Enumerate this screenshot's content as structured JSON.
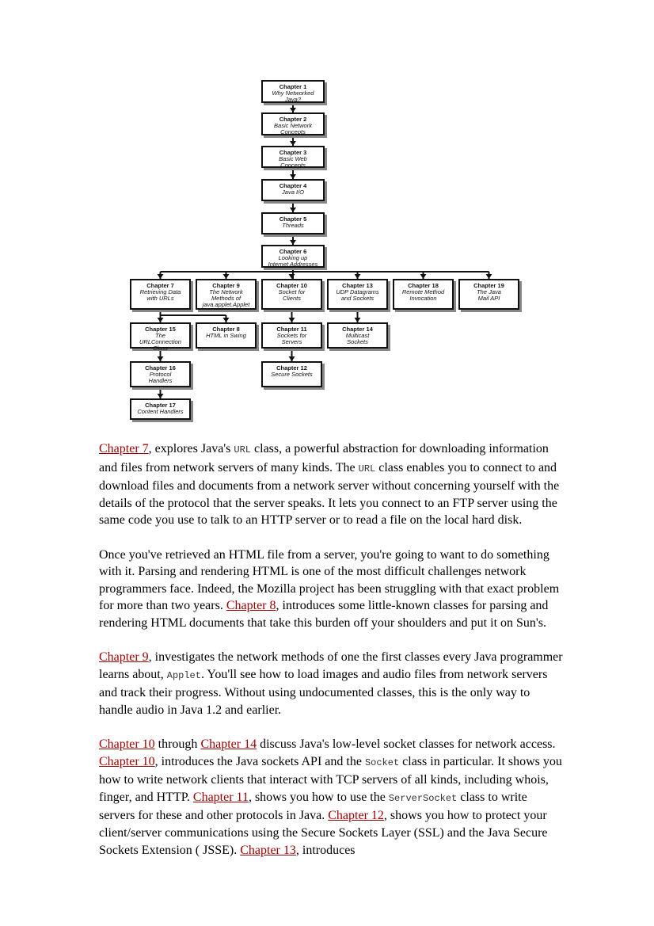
{
  "diagram": {
    "boxes": [
      {
        "id": "ch1",
        "title": "Chapter 1",
        "subtitle": "Why Networked\nJava?"
      },
      {
        "id": "ch2",
        "title": "Chapter 2",
        "subtitle": "Basic Network\nConcepts"
      },
      {
        "id": "ch3",
        "title": "Chapter 3",
        "subtitle": "Basic Web\nConcepts"
      },
      {
        "id": "ch4",
        "title": "Chapter 4",
        "subtitle": "Java I/O"
      },
      {
        "id": "ch5",
        "title": "Chapter 5",
        "subtitle": "Threads"
      },
      {
        "id": "ch6",
        "title": "Chapter 6",
        "subtitle": "Looking up\nInternet Addresses"
      },
      {
        "id": "ch7",
        "title": "Chapter 7",
        "subtitle": "Retrieving Data\nwith URLs"
      },
      {
        "id": "ch9",
        "title": "Chapter 9",
        "subtitle": "The Network\nMethods of\njava.applet.Applet"
      },
      {
        "id": "ch10",
        "title": "Chapter 10",
        "subtitle": "Socket for\nClients"
      },
      {
        "id": "ch13",
        "title": "Chapter 13",
        "subtitle": "UDP Datagrams\nand Sockets"
      },
      {
        "id": "ch18",
        "title": "Chapter 18",
        "subtitle": "Remote Method\nInvocation"
      },
      {
        "id": "ch19",
        "title": "Chapter 19",
        "subtitle": "The Java\nMail API"
      },
      {
        "id": "ch15",
        "title": "Chapter 15",
        "subtitle": "The\nURLConnection\nClass"
      },
      {
        "id": "ch8",
        "title": "Chapter 8",
        "subtitle": "HTML in Swing"
      },
      {
        "id": "ch11",
        "title": "Chapter 11",
        "subtitle": "Sockets for\nServers"
      },
      {
        "id": "ch14",
        "title": "Chapter 14",
        "subtitle": "Multicast\nSockets"
      },
      {
        "id": "ch16",
        "title": "Chapter 16",
        "subtitle": "Protocol\nHandlers"
      },
      {
        "id": "ch12",
        "title": "Chapter 12",
        "subtitle": "Secure Sockets"
      },
      {
        "id": "ch17",
        "title": "Chapter 17",
        "subtitle": "Content Handlers"
      }
    ],
    "edges": [
      [
        "ch1",
        "ch2"
      ],
      [
        "ch2",
        "ch3"
      ],
      [
        "ch3",
        "ch4"
      ],
      [
        "ch4",
        "ch5"
      ],
      [
        "ch5",
        "ch6"
      ],
      [
        "ch6",
        "ch7"
      ],
      [
        "ch6",
        "ch9"
      ],
      [
        "ch6",
        "ch10"
      ],
      [
        "ch6",
        "ch13"
      ],
      [
        "ch6",
        "ch18"
      ],
      [
        "ch6",
        "ch19"
      ],
      [
        "ch7",
        "ch15"
      ],
      [
        "ch7",
        "ch8"
      ],
      [
        "ch10",
        "ch11"
      ],
      [
        "ch13",
        "ch14"
      ],
      [
        "ch15",
        "ch16"
      ],
      [
        "ch11",
        "ch12"
      ],
      [
        "ch16",
        "ch17"
      ]
    ]
  },
  "paragraphs": [
    [
      {
        "t": "link",
        "v": "Chapter 7"
      },
      {
        "t": "text",
        "v": ", explores Java's "
      },
      {
        "t": "code",
        "v": "URL"
      },
      {
        "t": "text",
        "v": " class, a powerful abstraction for downloading information and files from network servers of many kinds. The "
      },
      {
        "t": "code",
        "v": "URL"
      },
      {
        "t": "text",
        "v": " class enables you to connect to and download files and documents from a network server without concerning yourself with the details of the protocol that the server speaks. It lets you connect to an FTP server using the same code you use to talk to an HTTP server or to read a file on the local hard disk."
      }
    ],
    [
      {
        "t": "text",
        "v": "Once you've retrieved an HTML file from a server, you're going to want to do something with it. Parsing and rendering HTML is one of the most difficult challenges network programmers face. Indeed, the Mozilla project has been struggling with that exact problem for more than two years. "
      },
      {
        "t": "link",
        "v": "Chapter 8"
      },
      {
        "t": "text",
        "v": ", introduces some little-known classes for parsing and rendering HTML documents that take this burden off your shoulders and put it on Sun's."
      }
    ],
    [
      {
        "t": "link",
        "v": "Chapter 9"
      },
      {
        "t": "text",
        "v": ", investigates the network methods of one the first classes every Java programmer learns about, "
      },
      {
        "t": "code",
        "v": "Applet"
      },
      {
        "t": "text",
        "v": ". You'll see how to load images and audio files from network servers and track their progress. Without using undocumented classes, this is the only way to handle audio in Java 1.2 and earlier."
      }
    ],
    [
      {
        "t": "link",
        "v": "Chapter 10"
      },
      {
        "t": "text",
        "v": " through "
      },
      {
        "t": "link",
        "v": "Chapter 14"
      },
      {
        "t": "text",
        "v": " discuss Java's low-level socket classes for network access. "
      },
      {
        "t": "link",
        "v": "Chapter 10"
      },
      {
        "t": "text",
        "v": ", introduces the Java sockets API and the "
      },
      {
        "t": "code",
        "v": "Socket"
      },
      {
        "t": "text",
        "v": " class in particular. It shows you how to write network clients that interact with TCP servers of all kinds, including whois, finger, and HTTP. "
      },
      {
        "t": "link",
        "v": "Chapter 11"
      },
      {
        "t": "text",
        "v": ", shows you how to use the "
      },
      {
        "t": "code",
        "v": "ServerSocket"
      },
      {
        "t": "text",
        "v": " class to write servers for these and other protocols in Java. "
      },
      {
        "t": "link",
        "v": "Chapter 12"
      },
      {
        "t": "text",
        "v": ", shows you how to protect your client/server communications using the Secure Sockets Layer (SSL) and the Java Secure Sockets Extension ( JSSE). "
      },
      {
        "t": "link",
        "v": "Chapter 13"
      },
      {
        "t": "text",
        "v": ", introduces"
      }
    ]
  ]
}
